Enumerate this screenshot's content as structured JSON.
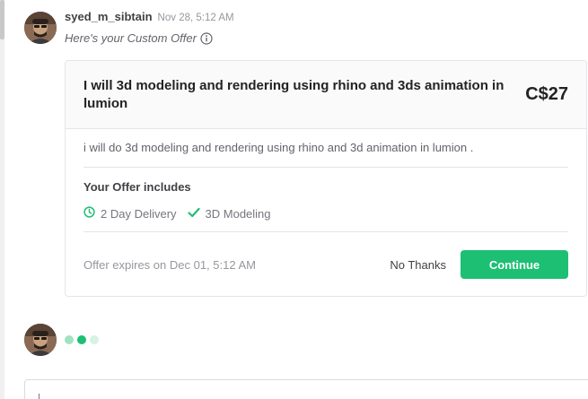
{
  "message": {
    "username": "syed_m_sibtain",
    "timestamp": "Nov 28, 5:12 AM",
    "intro": "Here's your Custom Offer",
    "info_icon": "info-icon"
  },
  "offer": {
    "title": "I will 3d modeling and rendering using rhino and 3ds animation in lumion",
    "price": "C$27",
    "description": "i will do 3d modeling and rendering using rhino and 3d animation in lumion .",
    "includes_title": "Your Offer includes",
    "includes": [
      {
        "icon": "clock-icon",
        "label": "2 Day Delivery"
      },
      {
        "icon": "check-icon",
        "label": "3D Modeling"
      }
    ],
    "expires": "Offer expires on Dec 01, 5:12 AM",
    "decline_label": "No Thanks",
    "accept_label": "Continue"
  },
  "colors": {
    "accent": "#1dbf73",
    "typing_dots": [
      "#9fe3c1",
      "#1dbf73",
      "#d6f3e4"
    ]
  }
}
